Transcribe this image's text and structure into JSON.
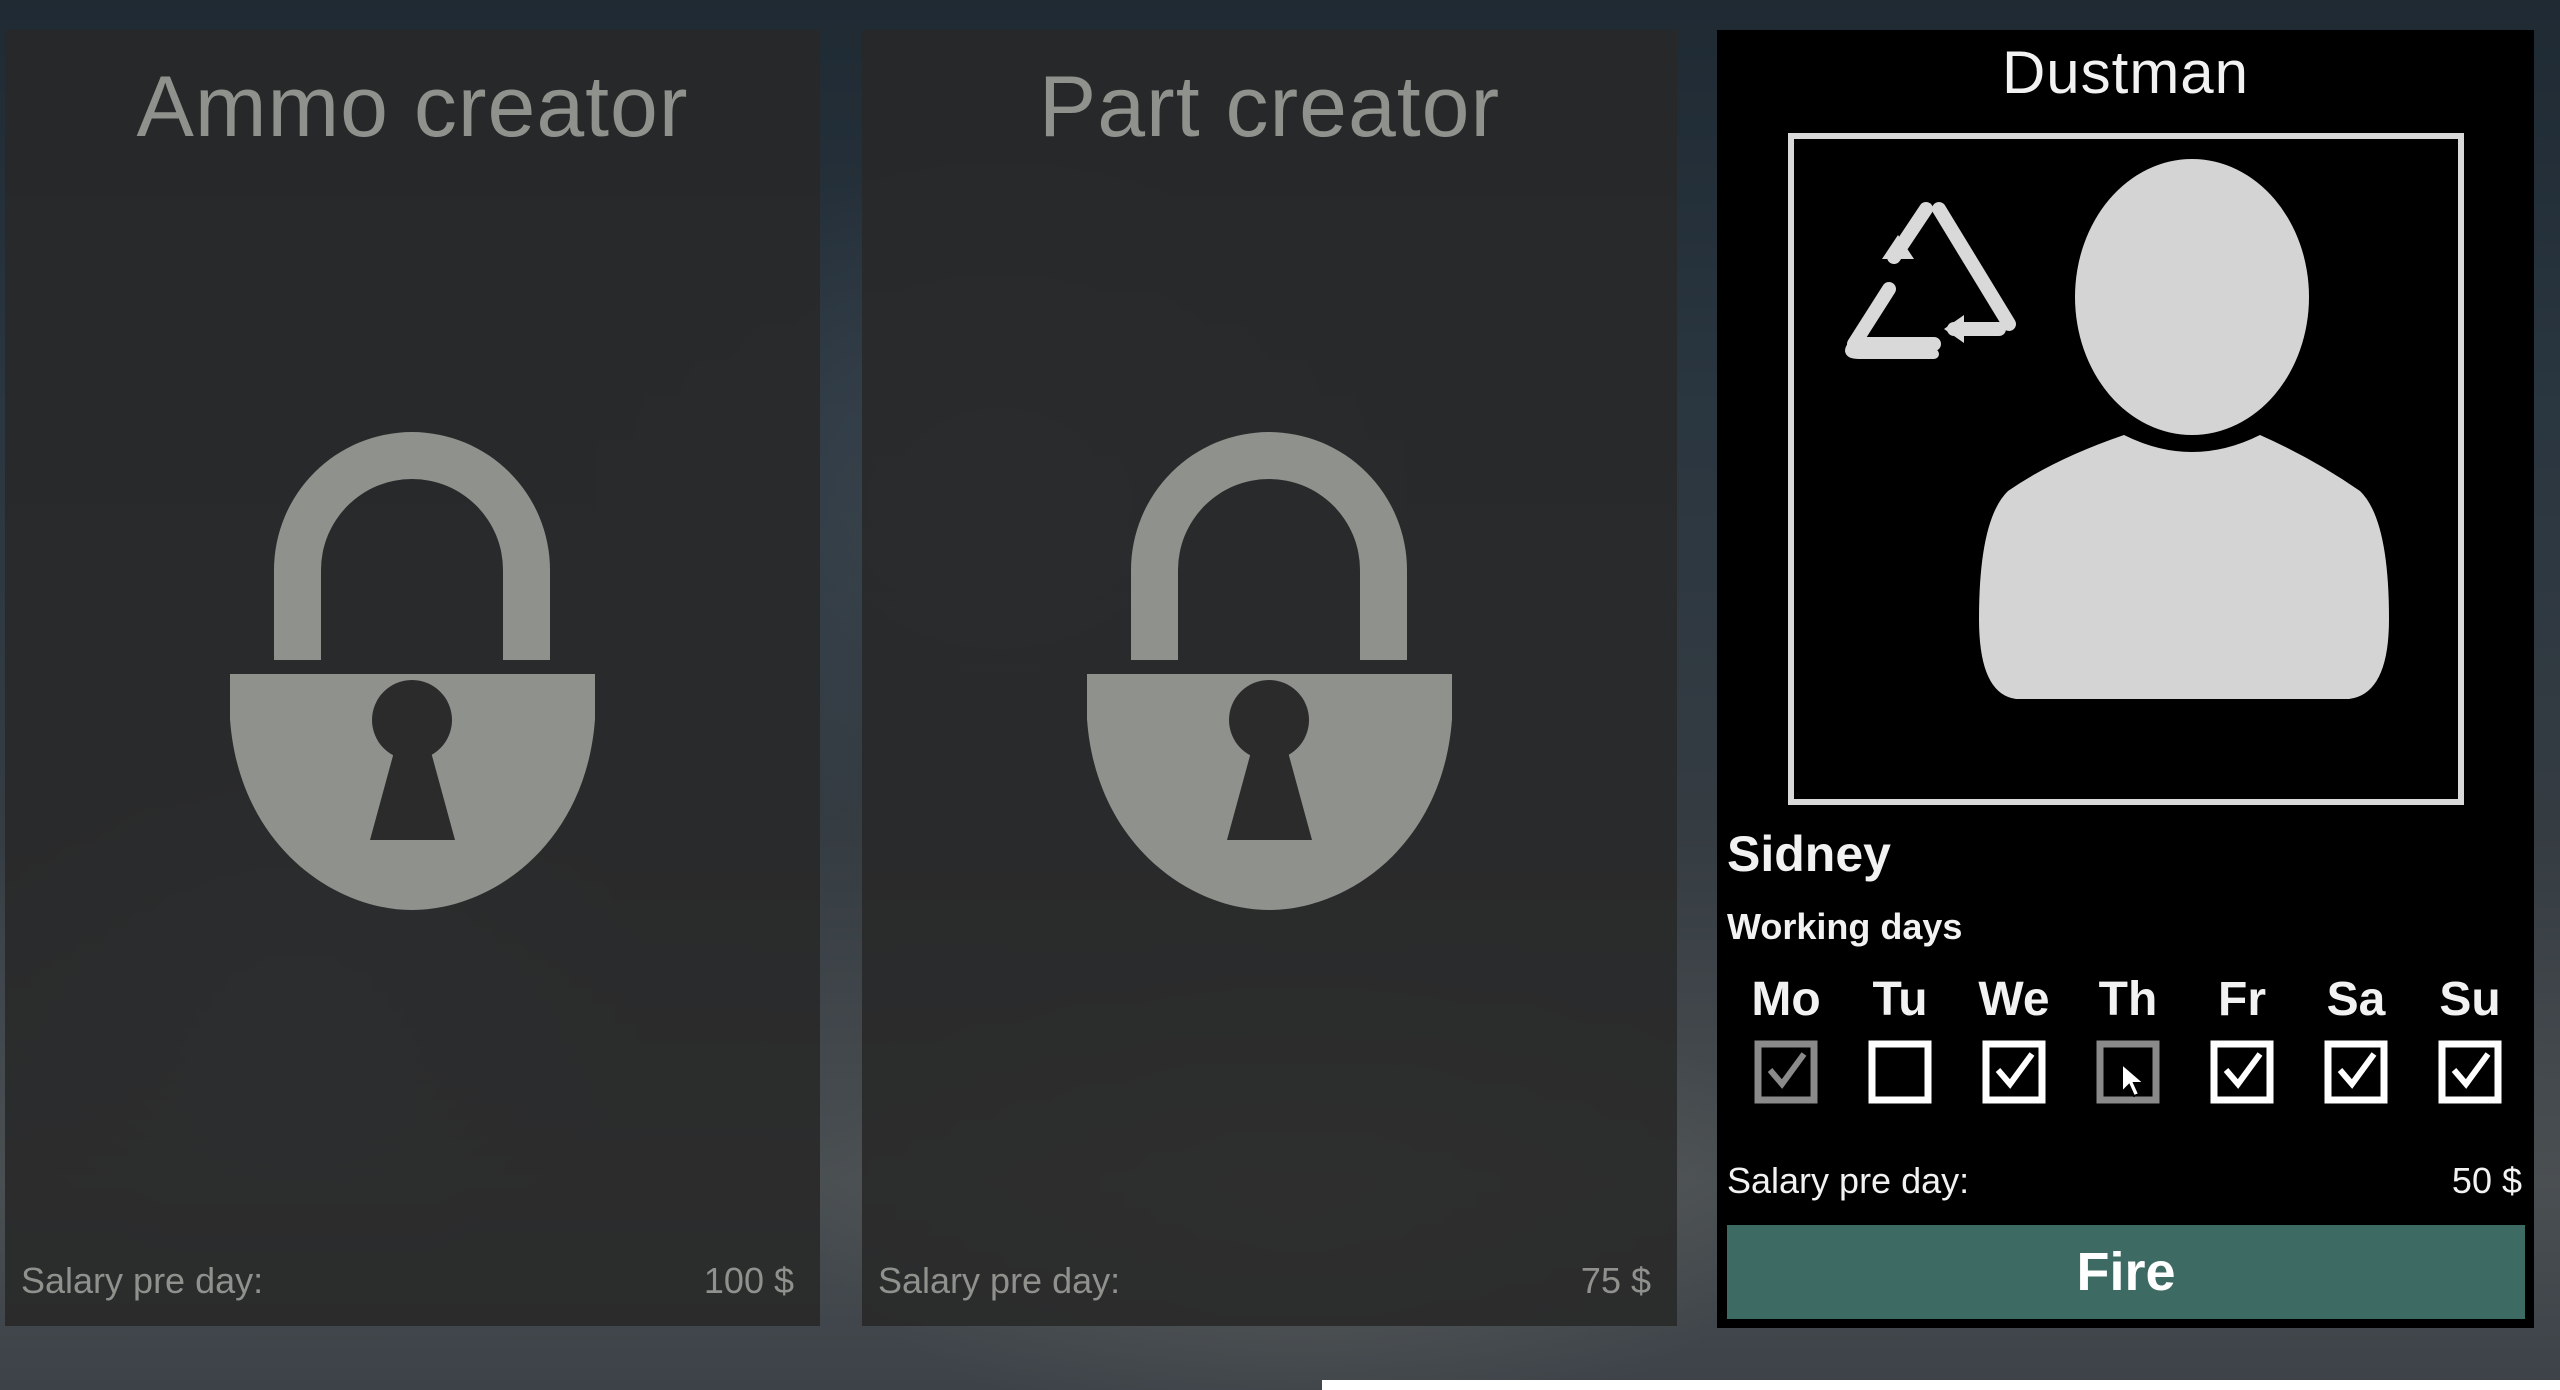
{
  "jobs": [
    {
      "title": "Ammo creator",
      "salary_label": "Salary pre day:",
      "salary_value": "100 $",
      "status": "locked"
    },
    {
      "title": "Part creator",
      "salary_label": "Salary pre day:",
      "salary_value": "75 $",
      "status": "locked"
    }
  ],
  "active_job": {
    "title": "Dustman",
    "employee_name": "Sidney",
    "working_days_label": "Working days",
    "days": [
      {
        "label": "Mo",
        "checked": true,
        "dimmed": true
      },
      {
        "label": "Tu",
        "checked": false,
        "dimmed": false
      },
      {
        "label": "We",
        "checked": true,
        "dimmed": false
      },
      {
        "label": "Th",
        "checked": false,
        "dimmed": true,
        "hovered": true
      },
      {
        "label": "Fr",
        "checked": true,
        "dimmed": false
      },
      {
        "label": "Sa",
        "checked": true,
        "dimmed": false
      },
      {
        "label": "Su",
        "checked": true,
        "dimmed": false
      }
    ],
    "salary_label": "Salary pre day:",
    "salary_value": "50 $",
    "fire_label": "Fire",
    "icons": [
      "recycle-icon",
      "person-silhouette-icon"
    ]
  },
  "colors": {
    "locked_text": "#8f918d",
    "active_text": "#f2f2f2",
    "fire_button": "#3d6a63",
    "dim_checkbox": "#8a8a8a"
  }
}
